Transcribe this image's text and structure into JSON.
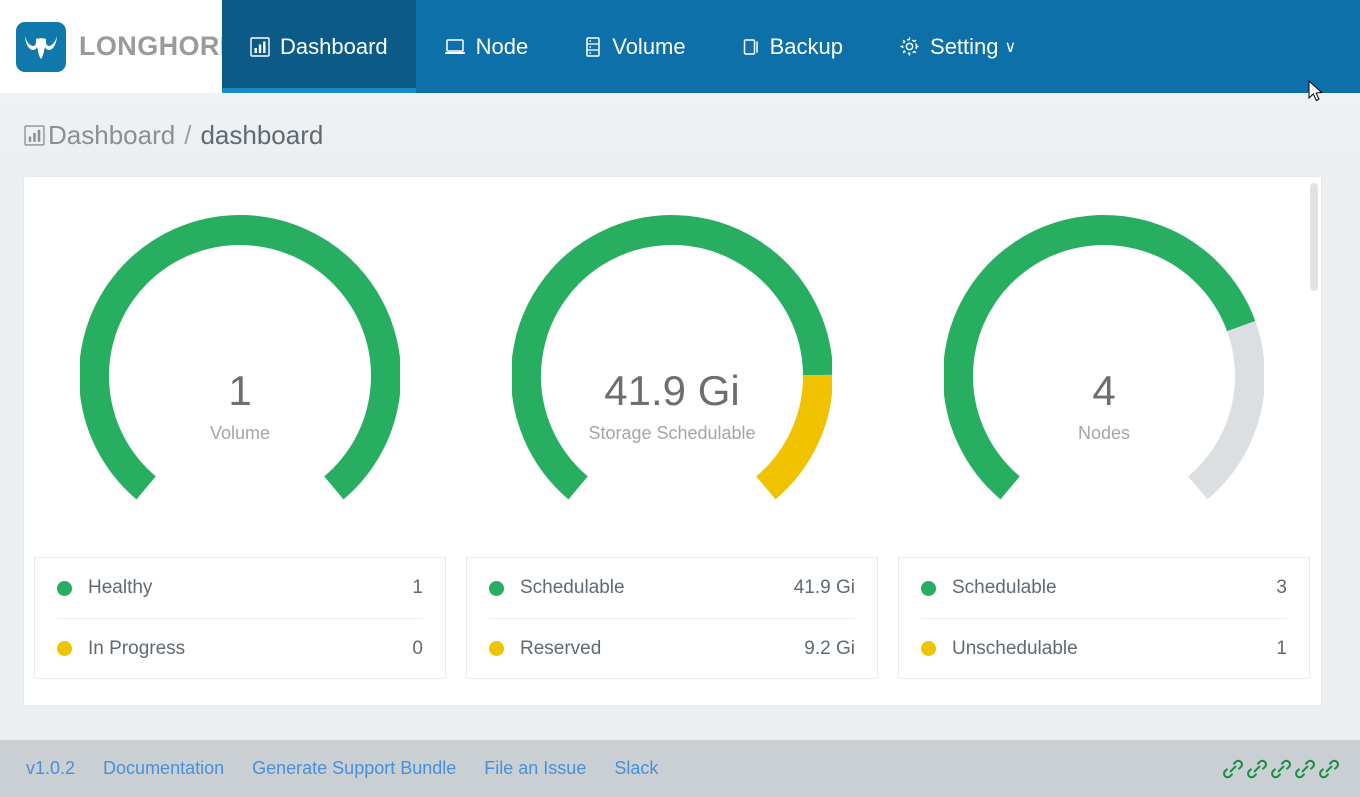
{
  "brand": {
    "name": "LONGHORN",
    "logo_icon": "longhorn-bull-icon",
    "logo_bg": "#1078ab"
  },
  "nav": {
    "active": "Dashboard",
    "items": [
      {
        "label": "Dashboard",
        "icon": "chart-bar-icon",
        "active": true
      },
      {
        "label": "Node",
        "icon": "node-laptop-icon",
        "active": false
      },
      {
        "label": "Volume",
        "icon": "volume-stack-icon",
        "active": false
      },
      {
        "label": "Backup",
        "icon": "backup-copy-icon",
        "active": false
      },
      {
        "label": "Setting",
        "icon": "gear-icon",
        "active": false,
        "caret": "∨"
      }
    ]
  },
  "breadcrumb": {
    "icon": "chart-bar-icon",
    "root": "Dashboard",
    "separator": "/",
    "current": "dashboard"
  },
  "colors": {
    "nav_bg": "#0d70a8",
    "nav_active_bg": "#0b5a88",
    "green": "#27ae60",
    "yellow": "#f0c200",
    "grey": "#dcdfe1",
    "link": "#4a90d9",
    "page_bg": "#eceff1",
    "footer_bg": "#c9cfd3"
  },
  "chart_data": [
    {
      "type": "pie",
      "title": "Volume",
      "center_value": "1",
      "center_label": "Volume",
      "gauge_sweep_degrees": 280,
      "segments": [
        {
          "name": "Healthy",
          "value": 1,
          "display": "1",
          "color": "#27ae60",
          "fraction": 1.0
        }
      ],
      "legend": [
        {
          "name": "Healthy",
          "value": "1",
          "color": "#27ae60"
        },
        {
          "name": "In Progress",
          "value": "0",
          "color": "#f0c200"
        }
      ]
    },
    {
      "type": "pie",
      "title": "Storage Schedulable",
      "center_value": "41.9 Gi",
      "center_label": "Storage Schedulable",
      "gauge_sweep_degrees": 280,
      "segments": [
        {
          "name": "Schedulable",
          "value": 41.9,
          "display": "41.9 Gi",
          "color": "#27ae60",
          "fraction": 0.82
        },
        {
          "name": "Reserved",
          "value": 9.2,
          "display": "9.2 Gi",
          "color": "#f0c200",
          "fraction": 0.18
        }
      ],
      "legend": [
        {
          "name": "Schedulable",
          "value": "41.9 Gi",
          "color": "#27ae60"
        },
        {
          "name": "Reserved",
          "value": "9.2 Gi",
          "color": "#f0c200"
        }
      ]
    },
    {
      "type": "pie",
      "title": "Nodes",
      "center_value": "4",
      "center_label": "Nodes",
      "gauge_sweep_degrees": 280,
      "segments": [
        {
          "name": "Schedulable",
          "value": 3,
          "display": "3",
          "color": "#27ae60",
          "fraction": 0.75
        },
        {
          "name": "Unschedulable",
          "value": 1,
          "display": "1",
          "color": "#dcdfe1",
          "fraction": 0.25
        }
      ],
      "legend": [
        {
          "name": "Schedulable",
          "value": "3",
          "color": "#27ae60"
        },
        {
          "name": "Unschedulable",
          "value": "1",
          "color": "#f0c200"
        }
      ]
    }
  ],
  "footer": {
    "version": "v1.0.2",
    "links": [
      "Documentation",
      "Generate Support Bundle",
      "File an Issue",
      "Slack"
    ],
    "icon_count": 5,
    "icon_name": "link-chain-icon"
  }
}
